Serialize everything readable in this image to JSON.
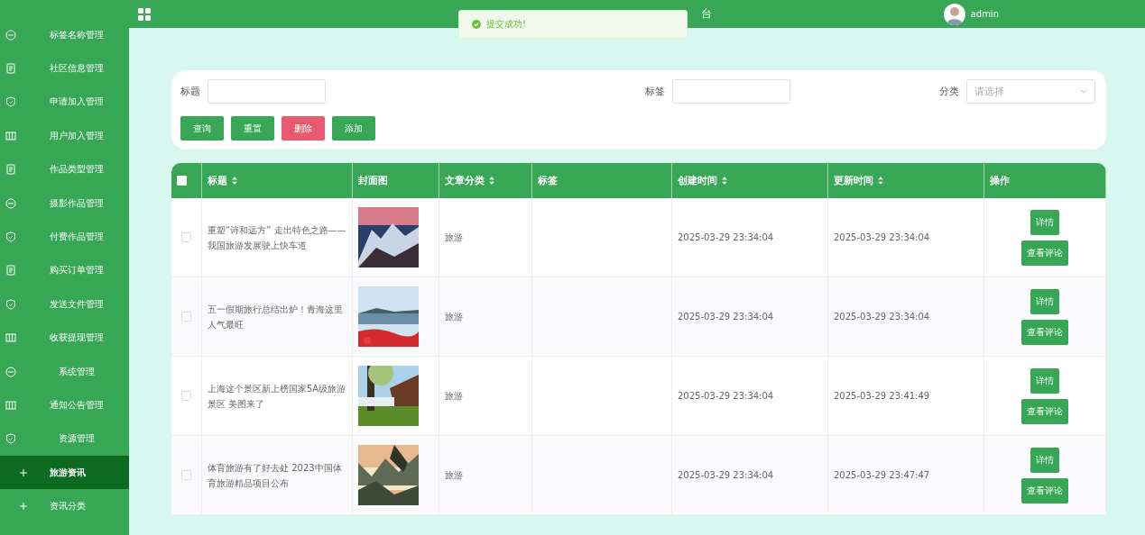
{
  "sidebar": {
    "items": [
      {
        "label": "标签名称管理",
        "kind": "menu",
        "selected": false
      },
      {
        "label": "社区信息管理",
        "kind": "menu",
        "selected": false
      },
      {
        "label": "申请加入管理",
        "kind": "menu",
        "selected": false
      },
      {
        "label": "用户加入管理",
        "kind": "menu",
        "selected": false
      },
      {
        "label": "作品类型管理",
        "kind": "menu",
        "selected": false
      },
      {
        "label": "摄影作品管理",
        "kind": "menu",
        "selected": false
      },
      {
        "label": "付费作品管理",
        "kind": "menu",
        "selected": false
      },
      {
        "label": "购买订单管理",
        "kind": "menu",
        "selected": false
      },
      {
        "label": "发送文件管理",
        "kind": "menu",
        "selected": false
      },
      {
        "label": "收获提现管理",
        "kind": "menu",
        "selected": false
      },
      {
        "label": "系统管理",
        "kind": "menu",
        "selected": false
      },
      {
        "label": "通知公告管理",
        "kind": "menu",
        "selected": false
      },
      {
        "label": "资源管理",
        "kind": "menu",
        "selected": false
      },
      {
        "label": "旅游资讯",
        "kind": "submenu",
        "selected": true
      },
      {
        "label": "资讯分类",
        "kind": "submenu",
        "selected": false
      }
    ]
  },
  "header": {
    "title": "台",
    "user": "admin"
  },
  "toast": {
    "message": "提交成功!"
  },
  "search": {
    "fields": [
      {
        "label": "标题",
        "kind": "input"
      },
      {
        "label": "标签",
        "kind": "input"
      },
      {
        "label": "分类",
        "kind": "select",
        "placeholder": "请选择"
      }
    ],
    "buttons": [
      {
        "label": "查询",
        "kind": "primary"
      },
      {
        "label": "重置",
        "kind": "primary"
      },
      {
        "label": "删除",
        "kind": "danger"
      },
      {
        "label": "添加",
        "kind": "primary"
      }
    ]
  },
  "table": {
    "all_checked": false,
    "columns": [
      {
        "label": "标题",
        "sortable": true
      },
      {
        "label": "封面图",
        "sortable": false
      },
      {
        "label": "文章分类",
        "sortable": true
      },
      {
        "label": "标签",
        "sortable": false
      },
      {
        "label": "创建时间",
        "sortable": true
      },
      {
        "label": "更新时间",
        "sortable": true
      },
      {
        "label": "操作",
        "sortable": false
      }
    ],
    "rows": [
      {
        "checked": false,
        "title": "重塑“诗和远方” 走出特色之路——我国旅游发展驶上快车道",
        "cover": {
          "kind": "picture"
        },
        "category": "旅游",
        "created": "2025-03-29 23:34:04",
        "updated": "2025-03-29 23:34:04",
        "actions": [
          "详情",
          "查看评论"
        ]
      },
      {
        "checked": false,
        "title": "五一假期旅行总结出炉！青海这里人气最旺",
        "cover": {
          "kind": "picture"
        },
        "category": "旅游",
        "created": "2025-03-29 23:34:04",
        "updated": "2025-03-29 23:34:04",
        "actions": [
          "详情",
          "查看评论"
        ]
      },
      {
        "checked": false,
        "title": "上海这个景区新上榜国家5A级旅游景区 美图来了",
        "cover": {
          "kind": "picture"
        },
        "category": "旅游",
        "created": "2025-03-29 23:34:04",
        "updated": "2025-03-29 23:41:49",
        "actions": [
          "详情",
          "查看评论"
        ]
      },
      {
        "checked": false,
        "title": "体育旅游有了好去处 2023中国体育旅游精品项目公布",
        "cover": {
          "kind": "picture"
        },
        "category": "旅游",
        "created": "2025-03-29 23:34:04",
        "updated": "2025-03-29 23:47:47",
        "actions": [
          "详情",
          "查看评论"
        ]
      }
    ]
  }
}
